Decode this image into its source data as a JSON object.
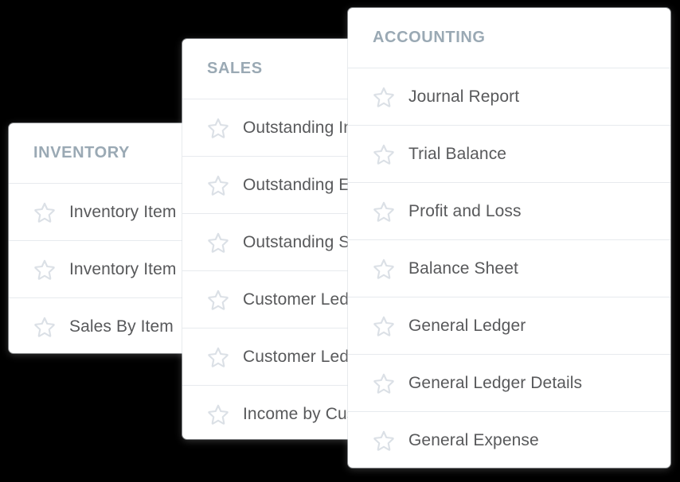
{
  "background_color": "#000000",
  "panel_background": "#ffffff",
  "header_color": "#9aa9b4",
  "item_text_color": "#58595b",
  "divider_color": "#e7eaee",
  "star_color": "#dbe0e6",
  "icon_name": "star-outline-icon",
  "panels": [
    {
      "id": "inventory",
      "title": "INVENTORY",
      "items": [
        {
          "label": "Inventory Item Report",
          "icon": "star-outline-icon"
        },
        {
          "label": "Inventory Item Details",
          "icon": "star-outline-icon"
        },
        {
          "label": "Sales By Item",
          "icon": "star-outline-icon"
        }
      ]
    },
    {
      "id": "sales",
      "title": "SALES",
      "items": [
        {
          "label": "Outstanding Invoices",
          "icon": "star-outline-icon"
        },
        {
          "label": "Outstanding Estimates",
          "icon": "star-outline-icon"
        },
        {
          "label": "Outstanding Statements",
          "icon": "star-outline-icon"
        },
        {
          "label": "Customer Ledger",
          "icon": "star-outline-icon"
        },
        {
          "label": "Customer Ledger Details",
          "icon": "star-outline-icon"
        },
        {
          "label": "Income by Customer",
          "icon": "star-outline-icon"
        }
      ]
    },
    {
      "id": "accounting",
      "title": "ACCOUNTING",
      "items": [
        {
          "label": "Journal Report",
          "icon": "star-outline-icon"
        },
        {
          "label": "Trial Balance",
          "icon": "star-outline-icon"
        },
        {
          "label": "Profit and Loss",
          "icon": "star-outline-icon"
        },
        {
          "label": "Balance Sheet",
          "icon": "star-outline-icon"
        },
        {
          "label": "General Ledger",
          "icon": "star-outline-icon"
        },
        {
          "label": "General Ledger Details",
          "icon": "star-outline-icon"
        },
        {
          "label": "General Expense",
          "icon": "star-outline-icon"
        }
      ]
    }
  ]
}
